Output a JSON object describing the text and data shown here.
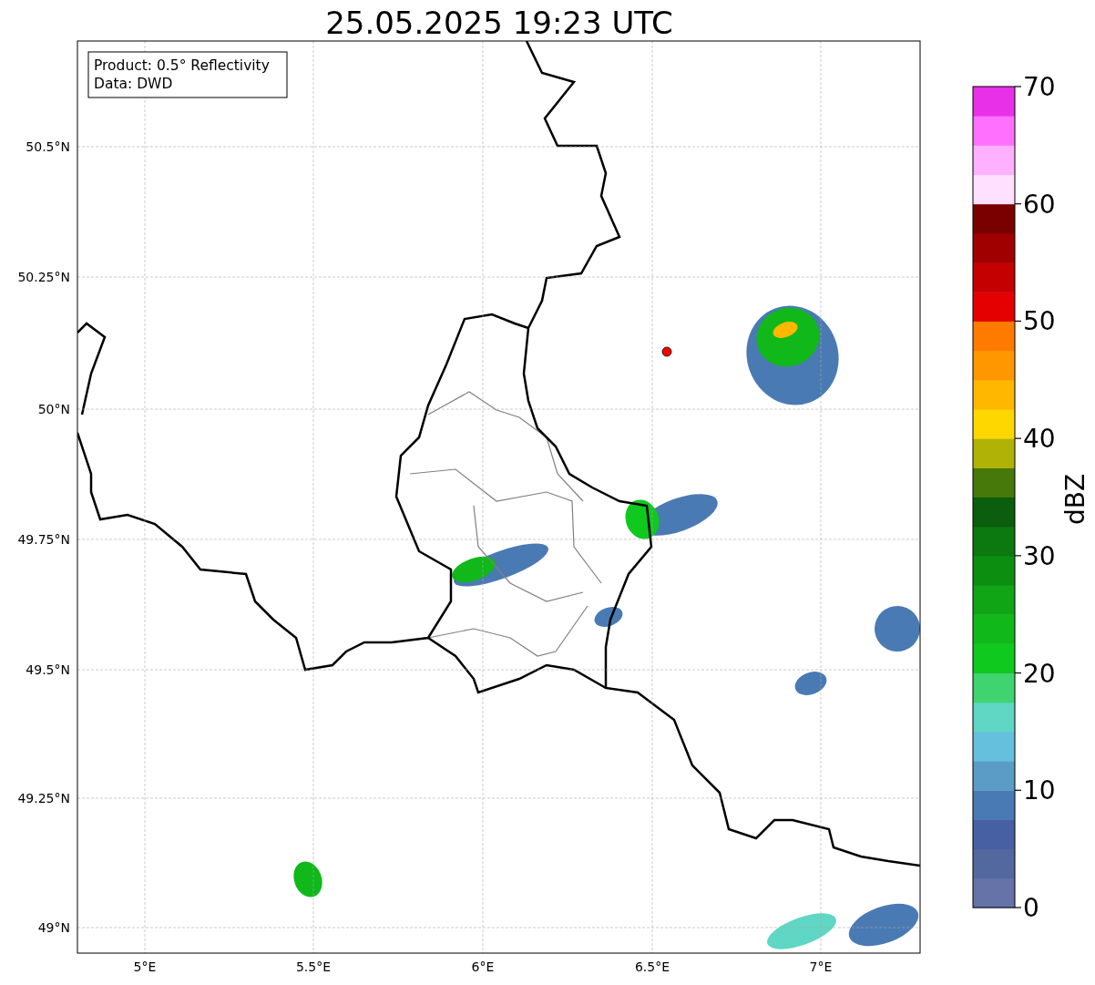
{
  "title": "25.05.2025 19:23 UTC",
  "map": {
    "legend": [
      "Product: 0.5° Reflectivity",
      "Data: DWD"
    ],
    "lat_ticks": [
      "50.5°N",
      "50.25°N",
      "50°N",
      "49.75°N",
      "49.5°N",
      "49.25°N",
      "49°N"
    ],
    "lon_ticks": [
      "5°E",
      "5.5°E",
      "6°E",
      "6.5°E",
      "7°E"
    ]
  },
  "colorbar": {
    "label": "dBZ",
    "ticks": [
      "70",
      "60",
      "50",
      "40",
      "30",
      "20",
      "10",
      "0"
    ],
    "bins": [
      {
        "color": "#6673a8"
      },
      {
        "color": "#5468a0"
      },
      {
        "color": "#4660a3"
      },
      {
        "color": "#4a7ab3"
      },
      {
        "color": "#5b9cc6"
      },
      {
        "color": "#64c0dc"
      },
      {
        "color": "#60d6c4"
      },
      {
        "color": "#3fd470"
      },
      {
        "color": "#10c91e"
      },
      {
        "color": "#10b81a"
      },
      {
        "color": "#10a515"
      },
      {
        "color": "#0c8e10"
      },
      {
        "color": "#0b7810"
      },
      {
        "color": "#0a5e0d"
      },
      {
        "color": "#46780a"
      },
      {
        "color": "#b0b305"
      },
      {
        "color": "#ffd700"
      },
      {
        "color": "#ffb700"
      },
      {
        "color": "#ff9800"
      },
      {
        "color": "#ff7b00"
      },
      {
        "color": "#e50000"
      },
      {
        "color": "#c40000"
      },
      {
        "color": "#a00000"
      },
      {
        "color": "#7a0000"
      },
      {
        "color": "#ffe0ff"
      },
      {
        "color": "#ffb0ff"
      },
      {
        "color": "#ff70ff"
      },
      {
        "color": "#e830e8"
      }
    ]
  }
}
